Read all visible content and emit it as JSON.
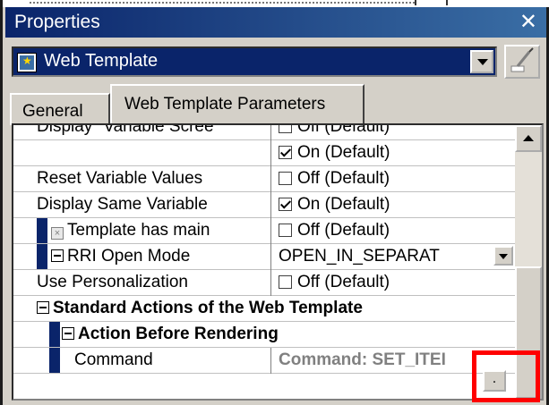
{
  "window": {
    "title": "Properties",
    "close_glyph": "✕"
  },
  "object_selector": {
    "selected": "Web Template",
    "icon": "web-template-icon"
  },
  "tabs": [
    {
      "label": "General",
      "active": false
    },
    {
      "label": "Web Template Parameters",
      "active": true
    }
  ],
  "grid": {
    "rows": [
      {
        "name": "Display \"Variable Scree",
        "value": "Off (Default)",
        "checked": false
      },
      {
        "name": "",
        "value": "On (Default)",
        "checked": true
      },
      {
        "name": "Reset Variable Values",
        "value": "Off (Default)",
        "checked": false
      },
      {
        "name": "Display Same Variable",
        "value": "On (Default)",
        "checked": true
      },
      {
        "name": "Template has main",
        "value": "Off (Default)",
        "checked": false
      },
      {
        "name": "RRI Open Mode",
        "value": "OPEN_IN_SEPARAT"
      },
      {
        "name": "Use Personalization",
        "value": "Off (Default)",
        "checked": false
      },
      {
        "name": "Standard Actions of the Web Template"
      },
      {
        "name": "Action Before Rendering"
      },
      {
        "name": "Command",
        "value": "Command: SET_ITEI"
      }
    ],
    "ellipsis_label": "."
  },
  "colors": {
    "title_bar": "#0a246a",
    "highlight": "#ff0000",
    "face": "#d4d0c8"
  }
}
